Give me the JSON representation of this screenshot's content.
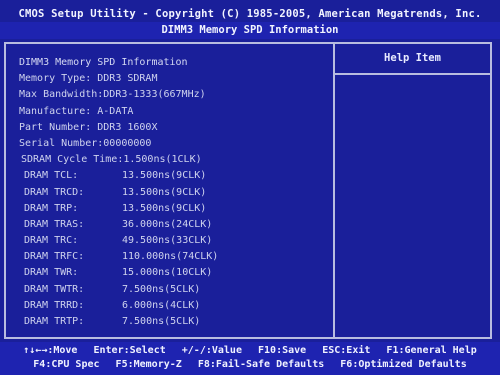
{
  "header": {
    "title": "CMOS Setup Utility - Copyright (C) 1985-2005, American Megatrends, Inc.",
    "subtitle": "DIMM3 Memory SPD Information"
  },
  "help_panel": {
    "title": "Help Item"
  },
  "spd": {
    "heading": "DIMM3 Memory SPD Information",
    "memory_type": "Memory Type: DDR3 SDRAM",
    "max_bandwidth": "Max Bandwidth:DDR3-1333(667MHz)",
    "manufacture": "Manufacture: A-DATA",
    "part_number": "Part Number: DDR3 1600X",
    "serial_number": "Serial Number:00000000",
    "cycle_time": "SDRAM Cycle Time:1.500ns(1CLK)",
    "timings": [
      {
        "label": "DRAM TCL:",
        "value": "13.500ns(9CLK)"
      },
      {
        "label": "DRAM TRCD:",
        "value": "13.500ns(9CLK)"
      },
      {
        "label": "DRAM TRP:",
        "value": "13.500ns(9CLK)"
      },
      {
        "label": "DRAM TRAS:",
        "value": "36.000ns(24CLK)"
      },
      {
        "label": "DRAM TRC:",
        "value": "49.500ns(33CLK)"
      },
      {
        "label": "DRAM TRFC:",
        "value": "110.000ns(74CLK)"
      },
      {
        "label": "DRAM TWR:",
        "value": "15.000ns(10CLK)"
      },
      {
        "label": "DRAM TWTR:",
        "value": "7.500ns(5CLK)"
      },
      {
        "label": "DRAM TRRD:",
        "value": "6.000ns(4CLK)"
      },
      {
        "label": "DRAM TRTP:",
        "value": "7.500ns(5CLK)"
      }
    ]
  },
  "footer": {
    "line1": [
      "↑↓←→:Move",
      "Enter:Select",
      "+/-/:Value",
      "F10:Save",
      "ESC:Exit",
      "F1:General Help"
    ],
    "line2": [
      "F4:CPU Spec",
      "F5:Memory-Z",
      "F8:Fail-Safe Defaults",
      "F6:Optimized Defaults"
    ]
  }
}
